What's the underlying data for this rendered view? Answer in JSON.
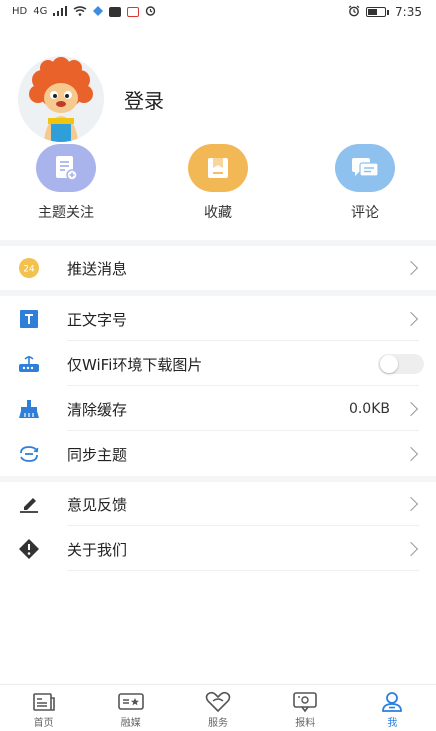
{
  "status_bar": {
    "left_icons": [
      "HD",
      "4G"
    ],
    "time": "7:35"
  },
  "profile": {
    "login_label": "登录"
  },
  "quick_actions": [
    {
      "label": "主题关注",
      "icon": "document-icon",
      "color": "#a9b4ec"
    },
    {
      "label": "收藏",
      "icon": "bookmark-icon",
      "color": "#f3b856"
    },
    {
      "label": "评论",
      "icon": "chat-icon",
      "color": "#8ec1ee"
    }
  ],
  "settings": {
    "push": {
      "label": "推送消息",
      "badge": "24"
    },
    "font_size": {
      "label": "正文字号"
    },
    "wifi_only": {
      "label": "仅WiFi环境下载图片"
    },
    "clear_cache": {
      "label": "清除缓存",
      "value": "0.0KB"
    },
    "sync_theme": {
      "label": "同步主题"
    },
    "feedback": {
      "label": "意见反馈"
    },
    "about": {
      "label": "关于我们"
    }
  },
  "bottom_nav": [
    {
      "label": "首页",
      "icon": "home-icon"
    },
    {
      "label": "融媒",
      "icon": "media-icon"
    },
    {
      "label": "服务",
      "icon": "heart-icon"
    },
    {
      "label": "报料",
      "icon": "report-icon"
    },
    {
      "label": "我",
      "icon": "person-icon",
      "active": true
    }
  ],
  "colors": {
    "accent": "#2a7fe0",
    "divider": "#f4f5f7"
  }
}
